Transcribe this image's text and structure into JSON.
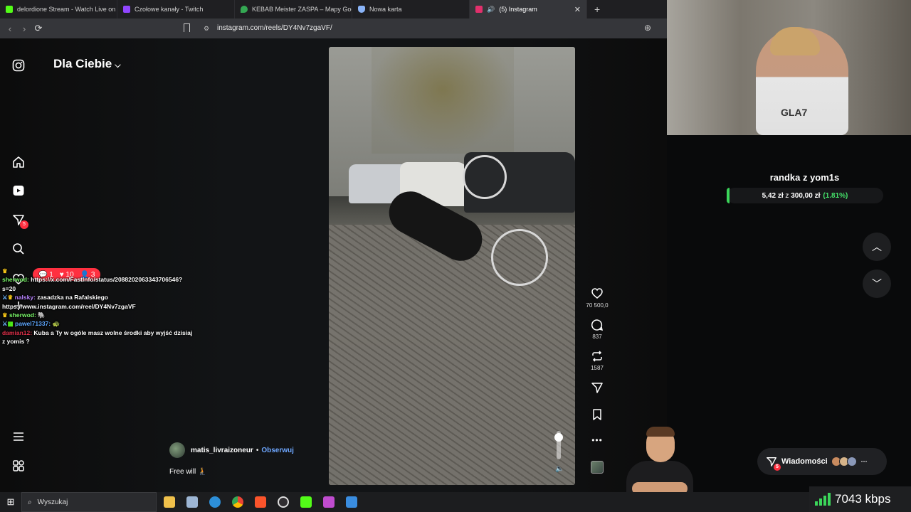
{
  "browser": {
    "tabs": [
      {
        "title": "delordione Stream - Watch Live on K",
        "icon_color": "#53fc18"
      },
      {
        "title": "Czołowe kanały - Twitch",
        "icon_color": "#9146ff"
      },
      {
        "title": "KEBAB Meister ZASPA – Mapy Googl",
        "icon_color": "#34a853"
      },
      {
        "title": "Nowa karta",
        "icon_color": "#8ab4f8"
      },
      {
        "title": "(5) Instagram",
        "icon_color": "#e1306c",
        "active": true
      }
    ],
    "new_tab": "+",
    "url": "instagram.com/reels/DY4Nv7zgaVF/"
  },
  "instagram": {
    "feed_title": "Dla Ciebie",
    "sidebar": {
      "notifications_badge": "5",
      "items": [
        "instagram-logo-icon",
        "home-icon",
        "reels-icon",
        "messages-icon",
        "search-icon",
        "notifications-icon",
        "create-icon",
        "menu-icon",
        "more-apps-icon"
      ]
    },
    "notif_pill": {
      "comments": "1",
      "likes": "10",
      "followers": "3"
    },
    "post": {
      "author": "matis_livraizoneur",
      "follow": "Obserwuj",
      "separator": "•",
      "caption": "Free will 🧎"
    },
    "actions": {
      "likes": "70 500,0",
      "comments": "837",
      "reposts": "1587"
    }
  },
  "chat": [
    {
      "user": "sherwod:",
      "user_color": "#7cfc6b",
      "text": "https://x.com/FastInfo/status/2088202063343706546?s=20"
    },
    {
      "user": "nalsky:",
      "user_color": "#b884ff",
      "text": "zasadzka na Rafalskiego https://www.instagram.com/reel/DY4Nv7zgaVF"
    },
    {
      "user": "sherwod:",
      "user_color": "#7cfc6b",
      "text": "🐘"
    },
    {
      "user": "pawel71337:",
      "user_color": "#5fa8ff",
      "text": "🐢"
    },
    {
      "user": "damian12:",
      "user_color": "#e0304a",
      "text": "Kuba a Ty w ogóle masz wolne środki aby wyjść dzisiaj z yomis ?"
    }
  ],
  "stream": {
    "goal_title": "randka z yom1s",
    "goal_current": "5,42 zł",
    "goal_sep": "z",
    "goal_target": "300,00 zł",
    "goal_pct": "(1.81%)",
    "goal_fraction": 0.0181,
    "messages_label": "Wiadomości",
    "messages_badge": "5",
    "messages_more": "···",
    "bitrate": "7043 kbps"
  },
  "taskbar": {
    "search_placeholder": "Wyszukaj",
    "apps": [
      "folder-icon",
      "gallery-icon",
      "edge-icon",
      "chrome-icon",
      "brave-icon",
      "obs-icon",
      "kick-icon",
      "chat-app-icon",
      "photo-app-icon"
    ]
  },
  "colors": {
    "accent_green": "#3bd65a",
    "notif_red": "#ff3040",
    "follow_blue": "#6ea7ff"
  }
}
